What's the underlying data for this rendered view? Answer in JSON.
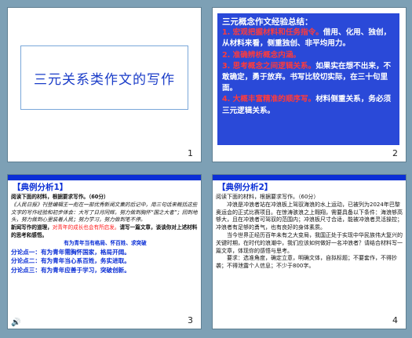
{
  "slides": [
    {
      "number": "1",
      "title": "三元关系类作文的写作"
    },
    {
      "number": "2",
      "heading": "三元概念作文经验总结：",
      "items": [
        {
          "label": "1. 宏观把握材料和任务指令。",
          "text": "借用、化用、独创，从材料来看，侧重独创、非平均用力。"
        },
        {
          "label": "2. 准确辨析概念内涵。",
          "text": ""
        },
        {
          "label": "3. 思考概念之间逻辑关系。",
          "text": "如果实在想不出来，不敢确定，勇于放弃。书写比较切实际，在三十句里面。"
        },
        {
          "label": "4. 大概丰富精准的顺序写。",
          "text": "材料侧重关系，务必须三元逻辑关系。"
        }
      ]
    },
    {
      "number": "3",
      "header": "【典例分析1】",
      "prompt": "阅读下面的材料，根据要求写作。（60分）",
      "material": "《人民日报》刊登编辑王一彪在一部优秀新闻文集的后记中，用三句话来概括这些文字的写作经验和初步体会：大写了日月同辉，努力做到胸怀“国之大者”；回到地头，努力做到心里装着人民；努力学习，努力做到笔不停。",
      "task_lead": "新闻写作的道理，",
      "task_red": "对青年的成长也会有所启发。",
      "task_tail": "请写一篇文章，谈谈你对上述材料的思考和感悟。",
      "sub_title": "有为青年当有格局、怀百姓、求突破",
      "points": [
        "分论点一：有为青年需胸怀国家，格局开阔。",
        "分论点二：有为青年当心系百姓，务实进取。",
        "分论点三：有为青年应善于学习，突破创新。"
      ]
    },
    {
      "number": "4",
      "header": "【典例分析2】",
      "prompt": "阅读下面的材料，根据要求写作。（60分）",
      "para1": "冲浪是冲浪者站在冲浪板上驾驭海浪的水上运动，已被列为2024年巴黎奥运会的正式比赛项目。在惊涛骇浪之上翱翔，需要具备以下条件：海浪够高够大，且在冲浪者可驾驭的范围内；冲浪板尺寸合适，能被冲浪者灵活操控；冲浪者有足够的勇气，也有良好的身体素质。",
      "para2": "当今世界正经历百年未有之大变局，我国正处于实现中华民族伟大复兴的关键时期，在时代的浪潮中，我们应该如何做好一名冲浪者？请结合材料写一篇文章，体现你的感悟与思考。",
      "requirements": "要求：选准角度，确定立意，明确文体，自拟标题；不要套作，不得抄袭；不得泄露个人信息；不少于800字。"
    }
  ],
  "footer_icon": "speaker-icon"
}
